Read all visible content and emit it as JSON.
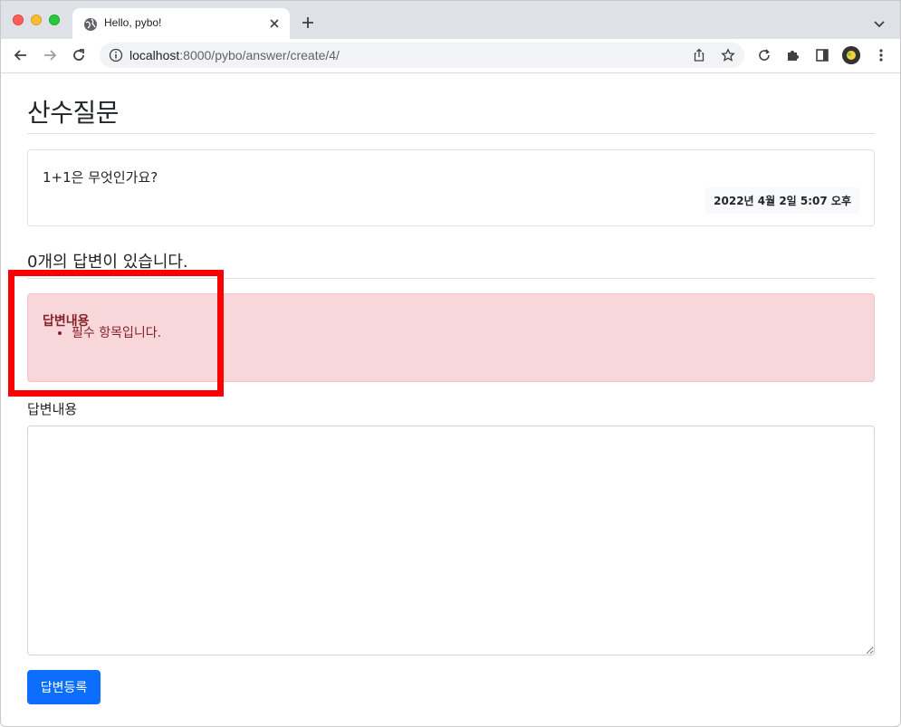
{
  "browser": {
    "tab_title": "Hello, pybo!",
    "url_host": "localhost",
    "url_rest": ":8000/pybo/answer/create/4/"
  },
  "question": {
    "subject": "산수질문",
    "content": "1+1은 무엇인가요?",
    "create_date": "2022년 4월 2일 5:07 오후"
  },
  "answers": {
    "count_text": "0개의 답변이 있습니다."
  },
  "errors": {
    "field_label": "답변내용",
    "messages": [
      "필수 항목입니다."
    ]
  },
  "form": {
    "content_label": "답변내용",
    "content_value": "",
    "submit_label": "답변등록"
  },
  "colors": {
    "primary": "#0d6efd",
    "danger_bg": "#f8d7da",
    "danger_text": "#842029",
    "highlight": "#ff0000"
  }
}
